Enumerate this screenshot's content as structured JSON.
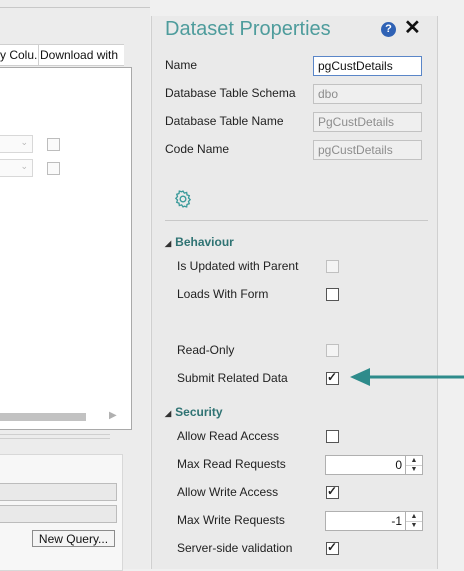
{
  "background_grid": {
    "columns": [
      "y Colu...",
      "Download with"
    ]
  },
  "query_buttons": {
    "new_query_label": "New Query..."
  },
  "panel": {
    "title": "Dataset Properties",
    "help_glyph": "?",
    "close_glyph": "✕",
    "accent_color": "#4e9c9c"
  },
  "properties": {
    "name": {
      "label": "Name",
      "value": "pgCustDetails"
    },
    "db_schema": {
      "label": "Database Table Schema",
      "value": "dbo"
    },
    "db_table": {
      "label": "Database Table Name",
      "value": "PgCustDetails"
    },
    "code_name": {
      "label": "Code Name",
      "value": "pgCustDetails"
    }
  },
  "tabs": {
    "settings_icon": "gear-icon"
  },
  "behaviour": {
    "heading": "Behaviour",
    "is_updated_with_parent": {
      "label": "Is Updated with Parent",
      "checked": false,
      "enabled": false
    },
    "loads_with_form": {
      "label": "Loads With Form",
      "checked": false,
      "enabled": true
    },
    "read_only": {
      "label": "Read-Only",
      "checked": false,
      "enabled": false
    },
    "submit_related_data": {
      "label": "Submit Related Data",
      "checked": true,
      "enabled": true
    }
  },
  "security": {
    "heading": "Security",
    "allow_read_access": {
      "label": "Allow Read Access",
      "checked": false
    },
    "max_read_requests": {
      "label": "Max Read Requests",
      "value": "0"
    },
    "allow_write_access": {
      "label": "Allow Write Access",
      "checked": true
    },
    "max_write_requests": {
      "label": "Max Write Requests",
      "value": "-1"
    },
    "server_side_validation": {
      "label": "Server-side validation",
      "checked": true
    }
  },
  "glyphs": {
    "check": "✓",
    "triangle": "◢",
    "spin_up": "▲",
    "spin_down": "▼",
    "combo_arrow": "⌄"
  },
  "annotation": {
    "arrow_color": "#2e8b8b"
  }
}
